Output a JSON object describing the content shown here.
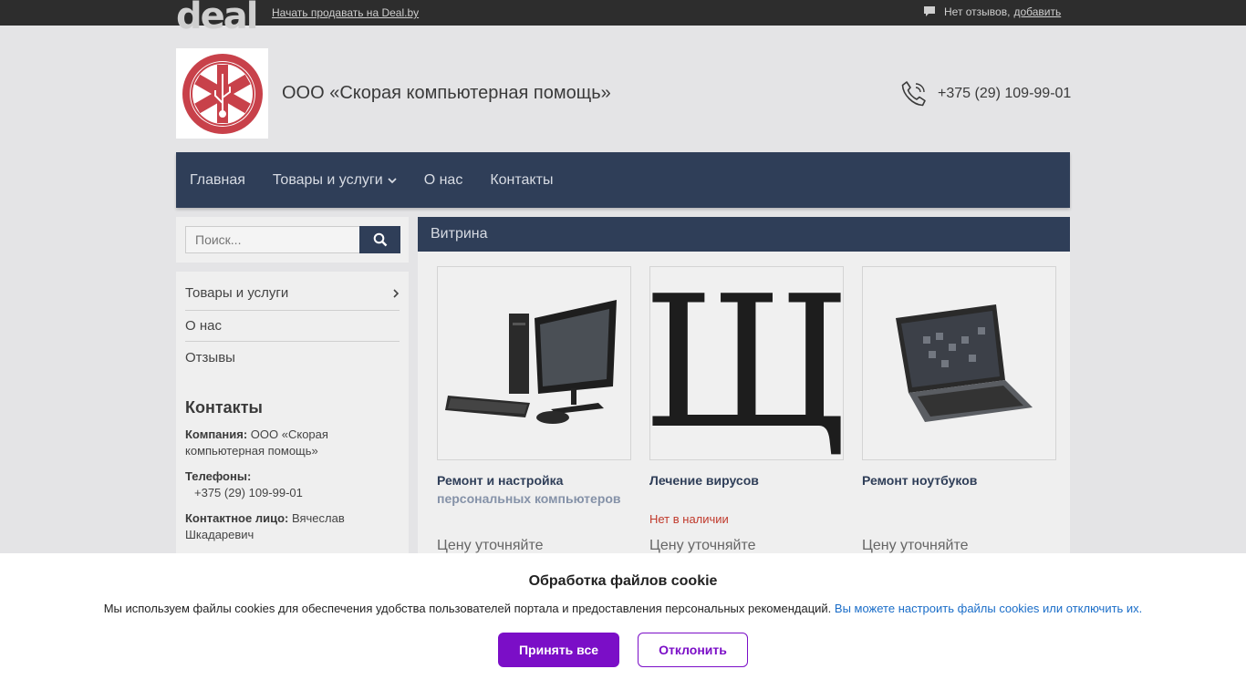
{
  "topbar": {
    "logo": "deal",
    "sell_link": "Начать продавать на Deal.by",
    "reviews_text": "Нет отзывов,",
    "reviews_add": "добавить"
  },
  "header": {
    "company_name": "ООО «Скорая компьютерная помощь»",
    "phone": "+375 (29) 109-99-01"
  },
  "nav": {
    "items": [
      {
        "label": "Главная"
      },
      {
        "label": "Товары и услуги"
      },
      {
        "label": "О нас"
      },
      {
        "label": "Контакты"
      }
    ]
  },
  "sidebar": {
    "search_placeholder": "Поиск...",
    "menu": [
      {
        "label": "Товары и услуги"
      },
      {
        "label": "О нас"
      },
      {
        "label": "Отзывы"
      }
    ],
    "contacts_title": "Контакты",
    "company_label": "Компания:",
    "company_value": "ООО «Скорая компьютерная помощь»",
    "phones_label": "Телефоны:",
    "phones_value": "+375 (29) 109-99-01",
    "person_label": "Контактное лицо:",
    "person_value": "Вячеслав Шкадаревич"
  },
  "main": {
    "title": "Витрина",
    "products": [
      {
        "name": "Ремонт и настройка",
        "name_cont": "персональных компьютеров",
        "status": "",
        "price": "Цену уточняйте"
      },
      {
        "name": "Лечение вирусов",
        "name_cont": "",
        "status": "Нет в наличии",
        "price": "Цену уточняйте"
      },
      {
        "name": "Ремонт ноутбуков",
        "name_cont": "",
        "status": "",
        "price": "Цену уточняйте"
      }
    ],
    "thumb_letter": "Щ"
  },
  "cookie": {
    "title": "Обработка файлов cookie",
    "text": "Мы используем файлы cookies для обеспечения удобства пользователей портала и предоставления персональных рекомендаций.",
    "link": "Вы можете настроить файлы cookies или отключить их.",
    "accept": "Принять все",
    "decline": "Отклонить"
  },
  "colors": {
    "nav_bg": "#2f3e58",
    "accent_purple": "#7b0ec7",
    "status_red": "#c0392b",
    "link_blue": "#1a6dc8"
  }
}
